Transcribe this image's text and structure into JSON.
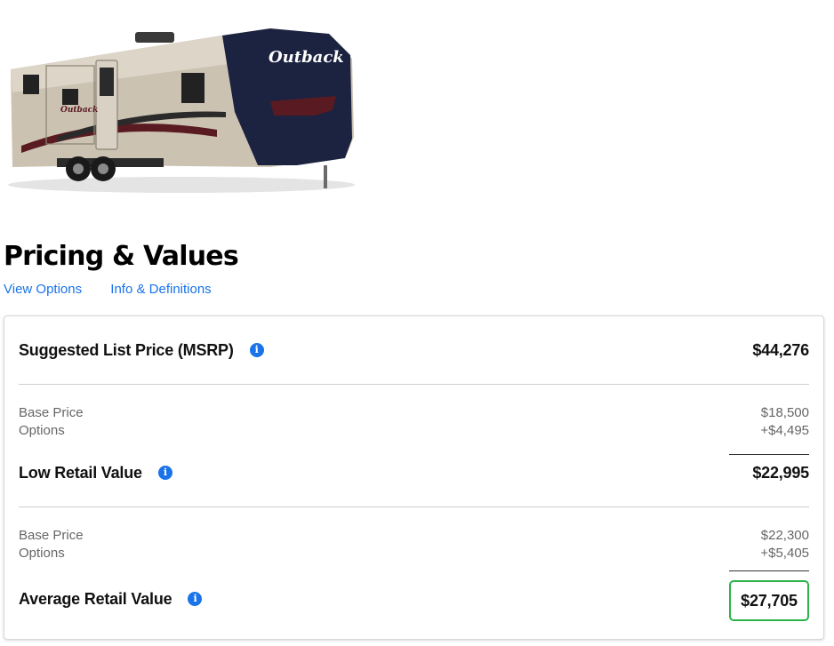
{
  "image": {
    "alt": "Outback travel trailer",
    "brand_text": "Outback",
    "body_color": "#cbc2b2",
    "cap_color": "#1c2340"
  },
  "page": {
    "title": "Pricing & Values",
    "links": {
      "view_options": "View Options",
      "info_definitions": "Info & Definitions"
    }
  },
  "pricing": {
    "msrp": {
      "label": "Suggested List Price (MSRP)",
      "value": "$44,276"
    },
    "low_retail": {
      "base_label": "Base Price",
      "base_value": "$18,500",
      "options_label": "Options",
      "options_value": "+$4,495",
      "label": "Low Retail Value",
      "value": "$22,995"
    },
    "average_retail": {
      "base_label": "Base Price",
      "base_value": "$22,300",
      "options_label": "Options",
      "options_value": "+$5,405",
      "label": "Average Retail Value",
      "value": "$27,705"
    },
    "info_glyph": "i"
  },
  "colors": {
    "link": "#1a73e8",
    "info_icon": "#1a73e8",
    "highlight_border": "#2bb34a",
    "muted_text": "#666666"
  }
}
